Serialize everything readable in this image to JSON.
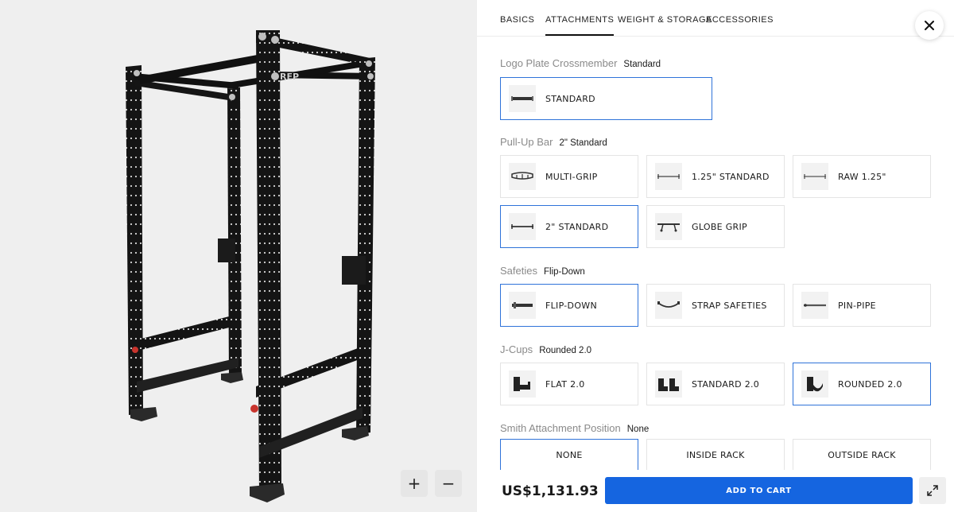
{
  "viewer": {
    "zoom_in_symbol": "+",
    "zoom_out_symbol": "−",
    "rack_logo_text": "REP"
  },
  "tabs": [
    {
      "label": "BASICS",
      "active": false
    },
    {
      "label": "ATTACHMENTS",
      "active": true
    },
    {
      "label": "WEIGHT & STORAGE",
      "active": false
    },
    {
      "label": "ACCESSORIES",
      "active": false
    }
  ],
  "sections": {
    "logo_plate": {
      "title": "Logo Plate Crossmember",
      "value": "Standard",
      "options": [
        {
          "label": "STANDARD",
          "selected": true,
          "icon": "crossmember-icon"
        }
      ]
    },
    "pullup": {
      "title": "Pull-Up Bar",
      "value": "2\" Standard",
      "options": [
        {
          "label": "MULTI-GRIP",
          "selected": false,
          "icon": "multi-grip-bar-icon"
        },
        {
          "label": "1.25\" STANDARD",
          "selected": false,
          "icon": "straight-bar-icon"
        },
        {
          "label": "RAW 1.25\"",
          "selected": false,
          "icon": "straight-bar-icon"
        },
        {
          "label": "2\" STANDARD",
          "selected": true,
          "icon": "straight-bar-icon"
        },
        {
          "label": "GLOBE GRIP",
          "selected": false,
          "icon": "globe-grip-bar-icon"
        }
      ]
    },
    "safeties": {
      "title": "Safeties",
      "value": "Flip-Down",
      "options": [
        {
          "label": "FLIP-DOWN",
          "selected": true,
          "icon": "flip-down-safety-icon"
        },
        {
          "label": "STRAP SAFETIES",
          "selected": false,
          "icon": "strap-safety-icon"
        },
        {
          "label": "PIN-PIPE",
          "selected": false,
          "icon": "pin-pipe-icon"
        }
      ]
    },
    "jcups": {
      "title": "J-Cups",
      "value": "Rounded 2.0",
      "options": [
        {
          "label": "FLAT 2.0",
          "selected": false,
          "icon": "j-cup-icon"
        },
        {
          "label": "STANDARD 2.0",
          "selected": false,
          "icon": "j-cup-icon"
        },
        {
          "label": "ROUNDED 2.0",
          "selected": true,
          "icon": "j-cup-icon"
        }
      ]
    },
    "smith": {
      "title": "Smith Attachment Position",
      "value": "None",
      "options": [
        {
          "label": "NONE",
          "selected": true
        },
        {
          "label": "INSIDE RACK",
          "selected": false
        },
        {
          "label": "OUTSIDE RACK",
          "selected": false
        }
      ]
    }
  },
  "footer": {
    "price": "US$1,131.93",
    "add_to_cart": "ADD TO CART"
  },
  "colors": {
    "accent": "#1565e0",
    "selected_border": "#2f73d9",
    "viewer_bg": "#efefef"
  }
}
